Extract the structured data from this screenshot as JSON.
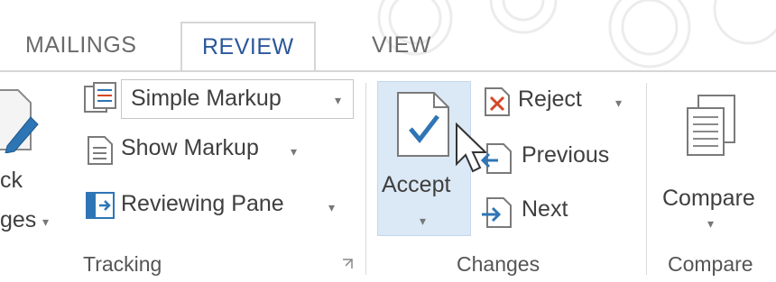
{
  "tabs": [
    {
      "label": "MAILINGS",
      "active": false
    },
    {
      "label": "REVIEW",
      "active": true
    },
    {
      "label": "VIEW",
      "active": false
    }
  ],
  "tracking": {
    "partial_button_line1": "ck",
    "partial_button_line2": "ges",
    "markup_select_value": "Simple Markup",
    "show_markup_label": "Show Markup",
    "reviewing_pane_label": "Reviewing Pane",
    "group_label": "Tracking"
  },
  "changes": {
    "accept_label": "Accept",
    "reject_label": "Reject",
    "previous_label": "Previous",
    "next_label": "Next",
    "group_label": "Changes"
  },
  "compare": {
    "compare_label": "Compare",
    "group_label": "Compare"
  },
  "colors": {
    "accent": "#2b579a",
    "accept_highlight": "#dbe8f5",
    "reject_red": "#d24726",
    "icon_blue": "#2e75b6"
  }
}
